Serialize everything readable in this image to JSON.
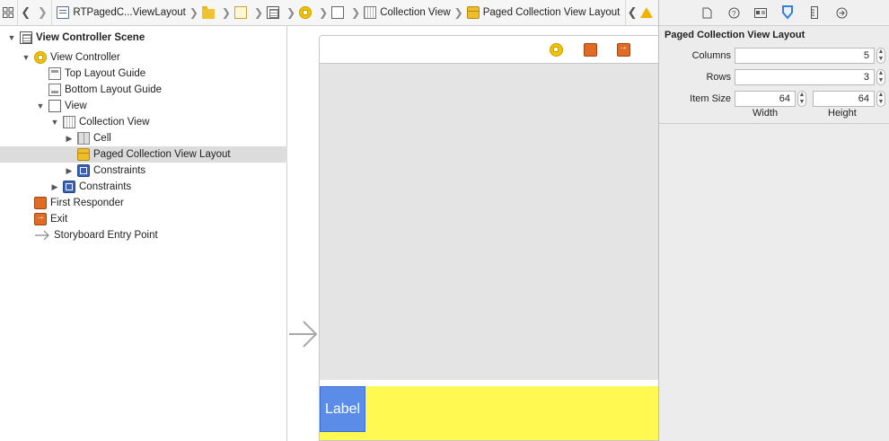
{
  "breadcrumbs": [
    {
      "label": "RTPagedC...ViewLayout",
      "icon": "file-icon"
    },
    {
      "label": "",
      "icon": "folder-icon"
    },
    {
      "label": "",
      "icon": "documents-icon"
    },
    {
      "label": "",
      "icon": "storyboard-icon"
    },
    {
      "label": "",
      "icon": "view-controller-icon"
    },
    {
      "label": "",
      "icon": "view-icon"
    },
    {
      "label": "Collection View",
      "icon": "collection-view-icon"
    },
    {
      "label": "Paged Collection View Layout",
      "icon": "cube-icon"
    }
  ],
  "outline": {
    "rows": [
      {
        "label": "View Controller Scene"
      },
      {
        "label": "View Controller"
      },
      {
        "label": "Top Layout Guide"
      },
      {
        "label": "Bottom Layout Guide"
      },
      {
        "label": "View"
      },
      {
        "label": "Collection View"
      },
      {
        "label": "Cell"
      },
      {
        "label": "Paged Collection View Layout"
      },
      {
        "label": "Constraints"
      },
      {
        "label": "Constraints"
      },
      {
        "label": "First Responder"
      },
      {
        "label": "Exit"
      },
      {
        "label": "Storyboard Entry Point"
      }
    ]
  },
  "canvas": {
    "cell_label": "Label",
    "colors": {
      "collection_bg": "#e4e4e4",
      "footer_bg": "#fff952",
      "label_bg": "#5b8de8"
    }
  },
  "inspector": {
    "title": "Paged Collection View Layout",
    "columns_label": "Columns",
    "columns_value": "5",
    "rows_label": "Rows",
    "rows_value": "3",
    "item_size_label": "Item Size",
    "width_value": "64",
    "height_value": "64",
    "width_label": "Width",
    "height_label": "Height"
  }
}
